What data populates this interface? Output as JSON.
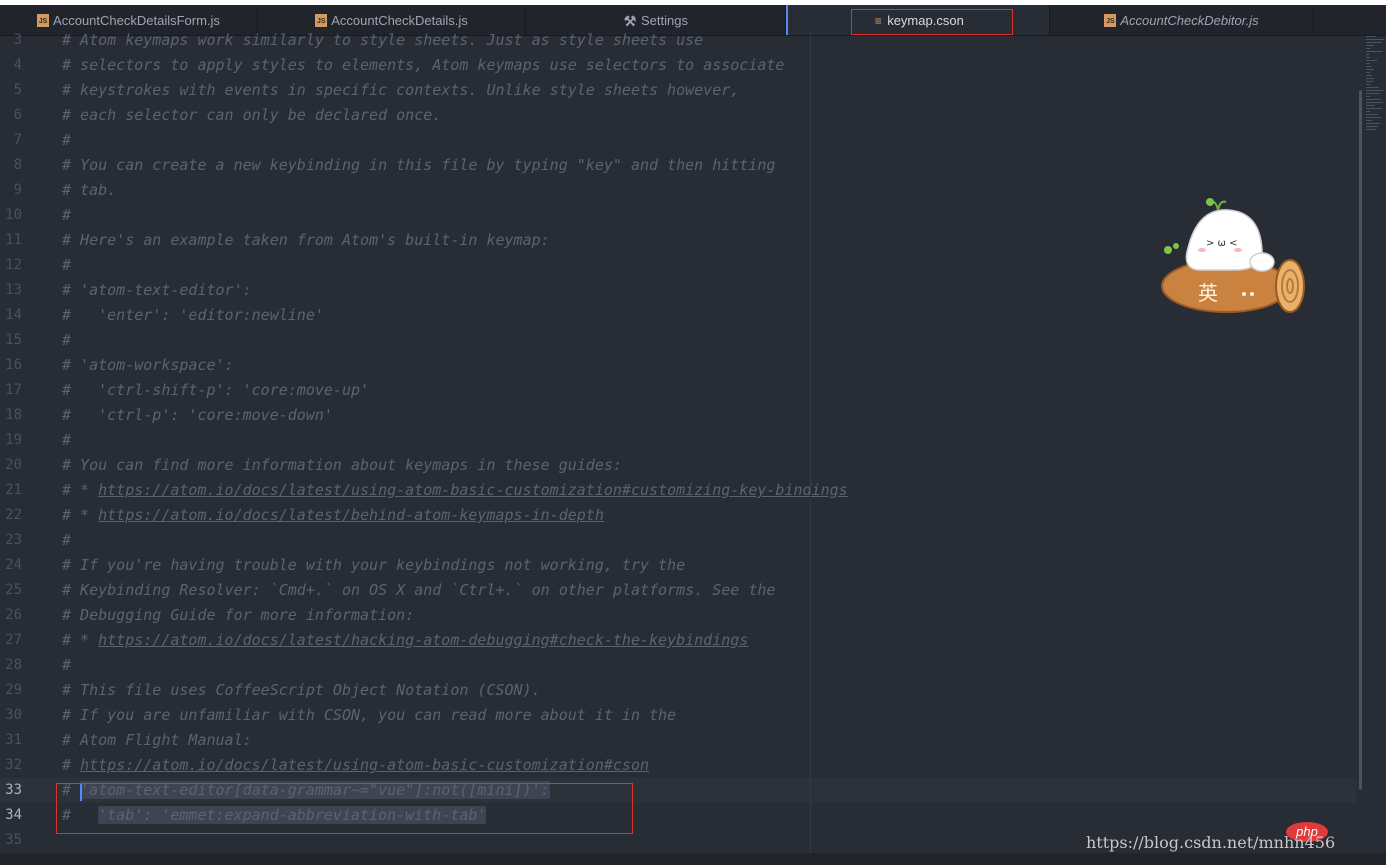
{
  "tabs": [
    {
      "icon": "js-file-icon",
      "icon_text": "JS",
      "label": "AccountCheckDetailsForm.js"
    },
    {
      "icon": "js-file-icon",
      "icon_text": "JS",
      "label": "AccountCheckDetails.js"
    },
    {
      "icon": "tools-icon",
      "icon_text": "⚒",
      "label": "Settings"
    },
    {
      "icon": "database-icon",
      "icon_text": "≡",
      "label": "keymap.cson",
      "active": true
    },
    {
      "icon": "js-file-icon",
      "icon_text": "JS",
      "label": "AccountCheckDebitor.js",
      "italic": true
    }
  ],
  "lines": [
    {
      "n": "3",
      "text": "# Atom keymaps work similarly to style sheets. Just as style sheets use"
    },
    {
      "n": "4",
      "text": "# selectors to apply styles to elements, Atom keymaps use selectors to associate"
    },
    {
      "n": "5",
      "text": "# keystrokes with events in specific contexts. Unlike style sheets however,"
    },
    {
      "n": "6",
      "text": "# each selector can only be declared once."
    },
    {
      "n": "7",
      "text": "#"
    },
    {
      "n": "8",
      "text": "# You can create a new keybinding in this file by typing \"key\" and then hitting"
    },
    {
      "n": "9",
      "text": "# tab."
    },
    {
      "n": "10",
      "text": "#"
    },
    {
      "n": "11",
      "text": "# Here's an example taken from Atom's built-in keymap:"
    },
    {
      "n": "12",
      "text": "#"
    },
    {
      "n": "13",
      "text": "# 'atom-text-editor':"
    },
    {
      "n": "14",
      "text": "#   'enter': 'editor:newline'"
    },
    {
      "n": "15",
      "text": "#"
    },
    {
      "n": "16",
      "text": "# 'atom-workspace':"
    },
    {
      "n": "17",
      "text": "#   'ctrl-shift-p': 'core:move-up'"
    },
    {
      "n": "18",
      "text": "#   'ctrl-p': 'core:move-down'"
    },
    {
      "n": "19",
      "text": "#"
    },
    {
      "n": "20",
      "text": "# You can find more information about keymaps in these guides:"
    },
    {
      "n": "21",
      "prefix": "# * ",
      "link": "https://atom.io/docs/latest/using-atom-basic-customization#customizing-key-bindings"
    },
    {
      "n": "22",
      "prefix": "# * ",
      "link": "https://atom.io/docs/latest/behind-atom-keymaps-in-depth"
    },
    {
      "n": "23",
      "text": "#"
    },
    {
      "n": "24",
      "text": "# If you're having trouble with your keybindings not working, try the"
    },
    {
      "n": "25",
      "text": "# Keybinding Resolver: `Cmd+.` on OS X and `Ctrl+.` on other platforms. See the"
    },
    {
      "n": "26",
      "text": "# Debugging Guide for more information:"
    },
    {
      "n": "27",
      "prefix": "# * ",
      "link": "https://atom.io/docs/latest/hacking-atom-debugging#check-the-keybindings"
    },
    {
      "n": "28",
      "text": "#"
    },
    {
      "n": "29",
      "text": "# This file uses CoffeeScript Object Notation (CSON)."
    },
    {
      "n": "30",
      "text": "# If you are unfamiliar with CSON, you can read more about it in the"
    },
    {
      "n": "31",
      "text": "# Atom Flight Manual:"
    },
    {
      "n": "32",
      "prefix": "# ",
      "link": "https://atom.io/docs/latest/using-atom-basic-customization#cson"
    },
    {
      "n": "33",
      "prefix": "# ",
      "selected": "'atom-text-editor[data-grammar~=\"vue\"]:not([mini])':",
      "highlight": true
    },
    {
      "n": "34",
      "prefix": "#   ",
      "selected": "'tab': 'emmet:expand-abbreviation-with-tab'",
      "current": true
    },
    {
      "n": "35",
      "text": ""
    }
  ],
  "watermark": "https://blog.csdn.net/mnhn456",
  "badge": "php",
  "mascot_char": "英"
}
